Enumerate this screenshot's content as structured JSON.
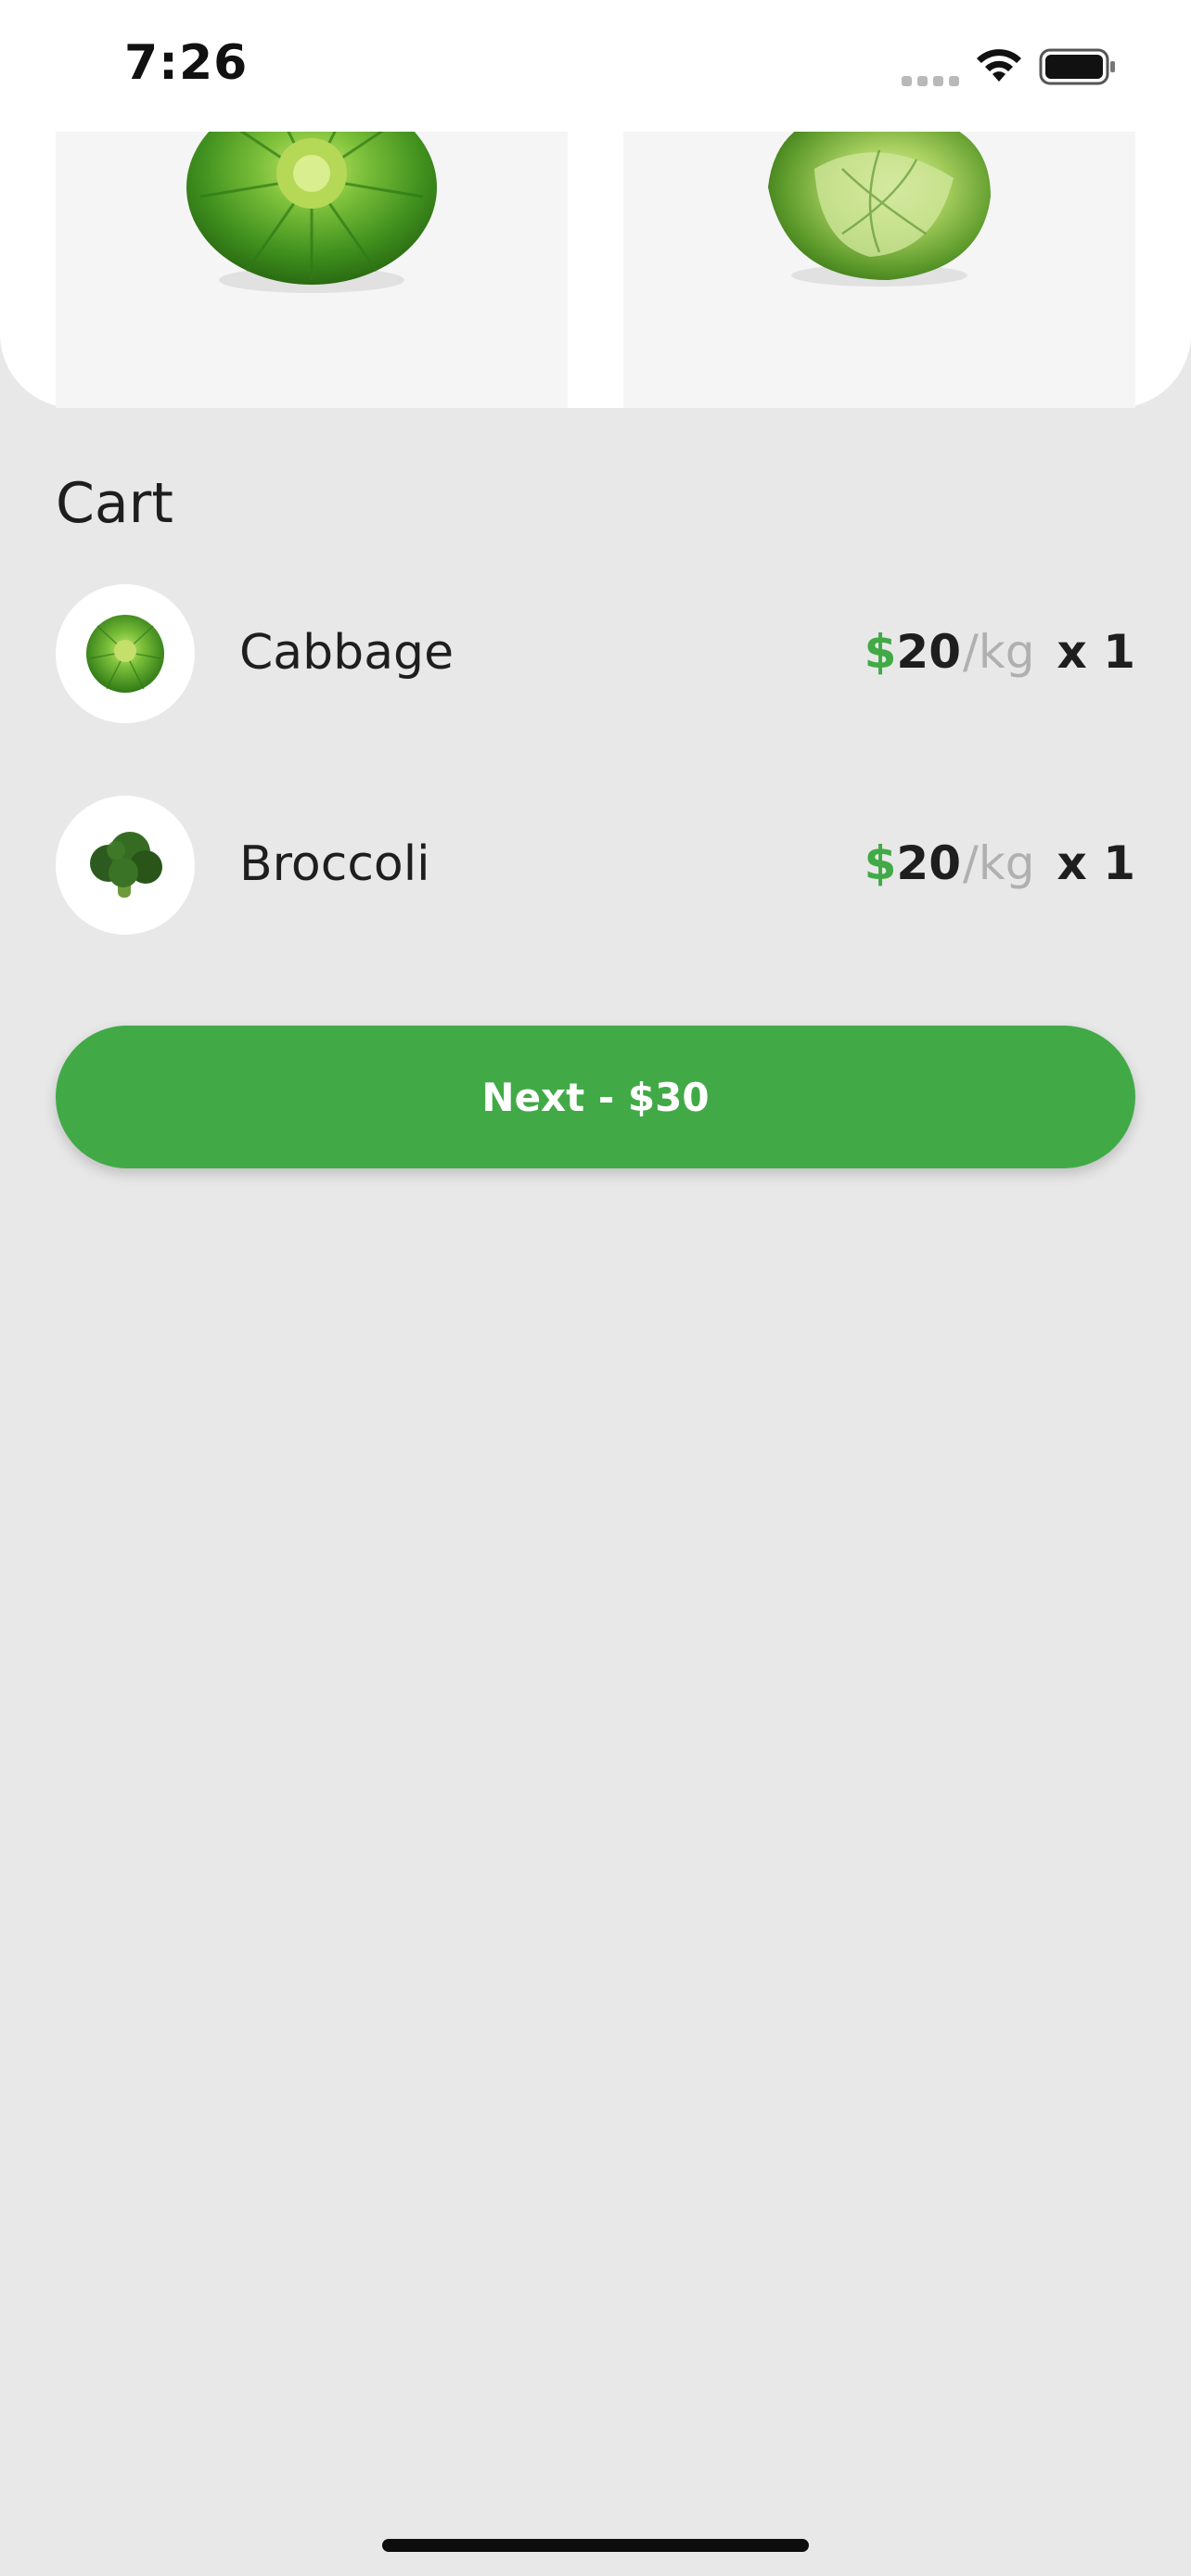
{
  "status_bar": {
    "time": "7:26"
  },
  "top_panel": {
    "products": [
      {
        "icon": "cabbage-image"
      },
      {
        "icon": "savoy-cabbage-image"
      }
    ]
  },
  "cart": {
    "title": "Cart",
    "items": [
      {
        "name": "Cabbage",
        "currency": "$",
        "price": "20",
        "unit": "/kg",
        "quantity": "x 1",
        "thumbnail": "cabbage-thumbnail"
      },
      {
        "name": "Broccoli",
        "currency": "$",
        "price": "20",
        "unit": "/kg",
        "quantity": "x 1",
        "thumbnail": "broccoli-thumbnail"
      }
    ]
  },
  "next_button": {
    "label": "Next - $30"
  },
  "colors": {
    "accent_green": "#41aa47",
    "background": "#e8e8e9",
    "card_background": "#f5f5f5",
    "muted_text": "#b0b0b0"
  }
}
